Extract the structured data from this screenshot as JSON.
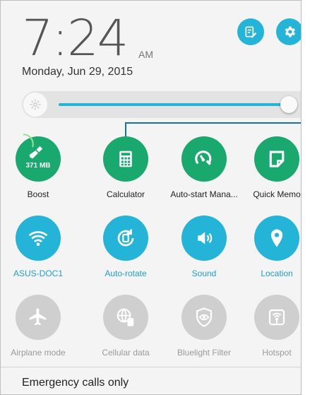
{
  "clock": {
    "time": "7:24",
    "ampm": "AM",
    "date": "Monday, Jun 29, 2015"
  },
  "header_buttons": [
    {
      "name": "edit-tiles-button",
      "icon": "edit-list-icon"
    },
    {
      "name": "settings-button",
      "icon": "gear-icon"
    }
  ],
  "brightness": {
    "level": 0.93,
    "icon": "brightness-icon"
  },
  "tiles": [
    {
      "label": "Boost",
      "style": "green",
      "icon": "broom-icon",
      "badge": "371 MB"
    },
    {
      "label": "Calculator",
      "style": "green",
      "icon": "calculator-icon"
    },
    {
      "label": "Auto-start Mana...",
      "style": "green",
      "icon": "speedometer-icon"
    },
    {
      "label": "Quick Memo",
      "style": "green",
      "icon": "memo-icon"
    },
    {
      "label": "ASUS-DOC1",
      "style": "blue",
      "icon": "wifi-icon"
    },
    {
      "label": "Auto-rotate",
      "style": "blue",
      "icon": "rotate-icon"
    },
    {
      "label": "Sound",
      "style": "blue",
      "icon": "speaker-icon"
    },
    {
      "label": "Location",
      "style": "blue",
      "icon": "location-pin-icon"
    },
    {
      "label": "Airplane mode",
      "style": "gray",
      "icon": "airplane-icon"
    },
    {
      "label": "Cellular data",
      "style": "gray",
      "icon": "cellular-data-icon"
    },
    {
      "label": "Bluelight Filter",
      "style": "gray",
      "icon": "eye-shield-icon"
    },
    {
      "label": "Hotspot",
      "style": "gray",
      "icon": "hotspot-icon"
    }
  ],
  "status": {
    "emergency": "Emergency calls only"
  },
  "colors": {
    "accent": "#23b4d8",
    "green": "#19a86d",
    "disabled": "#cfcfcf"
  }
}
